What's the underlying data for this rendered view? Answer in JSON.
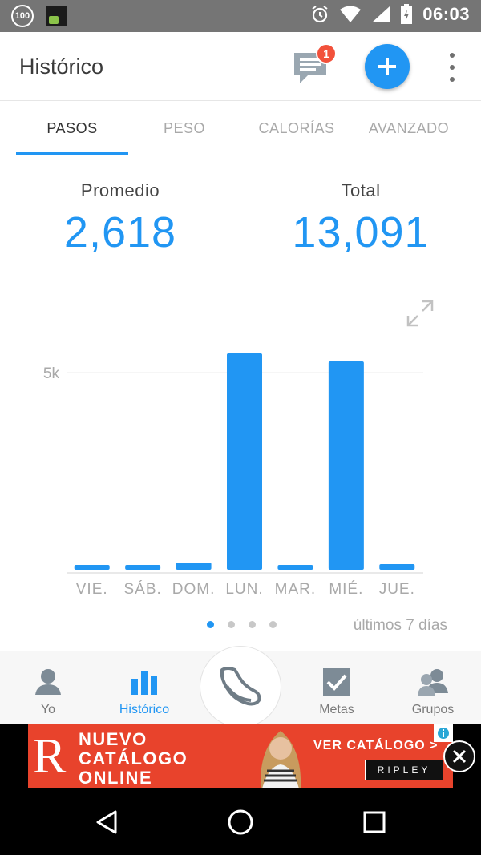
{
  "status_bar": {
    "battery_badge": "100",
    "time": "06:03"
  },
  "app_bar": {
    "title": "Histórico",
    "messages_badge": "1"
  },
  "tabs": [
    {
      "label": "PASOS",
      "active": true
    },
    {
      "label": "PESO",
      "active": false
    },
    {
      "label": "CALORÍAS",
      "active": false
    },
    {
      "label": "AVANZADO",
      "active": false
    }
  ],
  "stats": {
    "average_label": "Promedio",
    "average_value": "2,618",
    "total_label": "Total",
    "total_value": "13,091"
  },
  "chart_data": {
    "type": "bar",
    "categories": [
      "VIE.",
      "SÁB.",
      "DOM.",
      "LUN.",
      "MAR.",
      "MIÉ.",
      "JUE."
    ],
    "values": [
      120,
      120,
      180,
      5400,
      120,
      5200,
      140
    ],
    "y_tick_labels": [
      "5k"
    ],
    "y_ticks": [
      5000
    ],
    "ylim": [
      0,
      6700
    ],
    "grid": true,
    "color": "#2196f3"
  },
  "pager": {
    "pages": 4,
    "active_index": 0,
    "range_label": "últimos 7 días"
  },
  "bottom_nav": [
    {
      "label": "Yo",
      "icon": "person-icon",
      "active": false
    },
    {
      "label": "Histórico",
      "icon": "bar-chart-icon",
      "active": true
    },
    {
      "label": "Metas",
      "icon": "checkbox-icon",
      "active": false
    },
    {
      "label": "Grupos",
      "icon": "group-icon",
      "active": false
    }
  ],
  "center_button": {
    "icon": "shoe-icon"
  },
  "ad": {
    "logo": "R",
    "lines": [
      "NUEVO",
      "CATÁLOGO",
      "ONLINE"
    ],
    "cta": "VER CATÁLOGO >",
    "brand": "RIPLEY"
  }
}
